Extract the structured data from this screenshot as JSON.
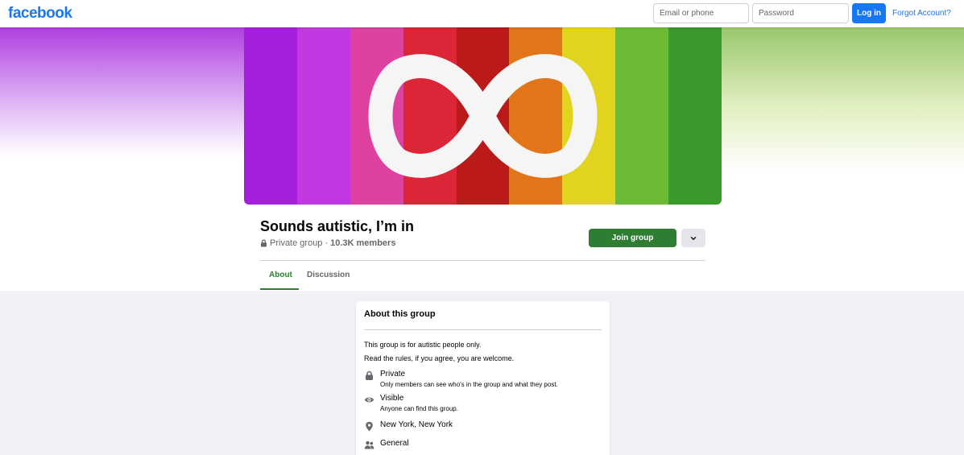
{
  "topbar": {
    "logo": "facebook",
    "email_placeholder": "Email or phone",
    "password_placeholder": "Password",
    "login_label": "Log in",
    "forgot_label": "Forgot Account?"
  },
  "cover": {
    "stripe_colors": [
      "#a51fdc",
      "#c238e0",
      "#de419f",
      "#dc2638",
      "#bb1a1a",
      "#e2741a",
      "#e2d41e",
      "#6dbb34",
      "#3b9a2c"
    ],
    "symbol": "infinity-icon",
    "symbol_color": "#f5f5f5"
  },
  "group": {
    "name": "Sounds autistic, I’m in",
    "privacy": "Private group",
    "separator": "·",
    "members": "10.3K members",
    "join_label": "Join group",
    "more_icon": "chevron-down-icon"
  },
  "tabs": [
    {
      "label": "About",
      "active": true
    },
    {
      "label": "Discussion",
      "active": false
    }
  ],
  "colors": {
    "brand": "#1877f2",
    "accent_green": "#2e7d32",
    "muted": "#65676b"
  },
  "about": {
    "title": "About this group",
    "description": [
      "This group is for autistic people only.",
      "Read the rules, if you agree, you are welcome."
    ],
    "items": [
      {
        "icon": "lock-icon",
        "title": "Private",
        "subtitle": "Only members can see who's in the group and what they post."
      },
      {
        "icon": "eye-icon",
        "title": "Visible",
        "subtitle": "Anyone can find this group."
      },
      {
        "icon": "location-pin-icon",
        "title": "New York, New York"
      },
      {
        "icon": "people-icon",
        "title": "General"
      }
    ]
  }
}
